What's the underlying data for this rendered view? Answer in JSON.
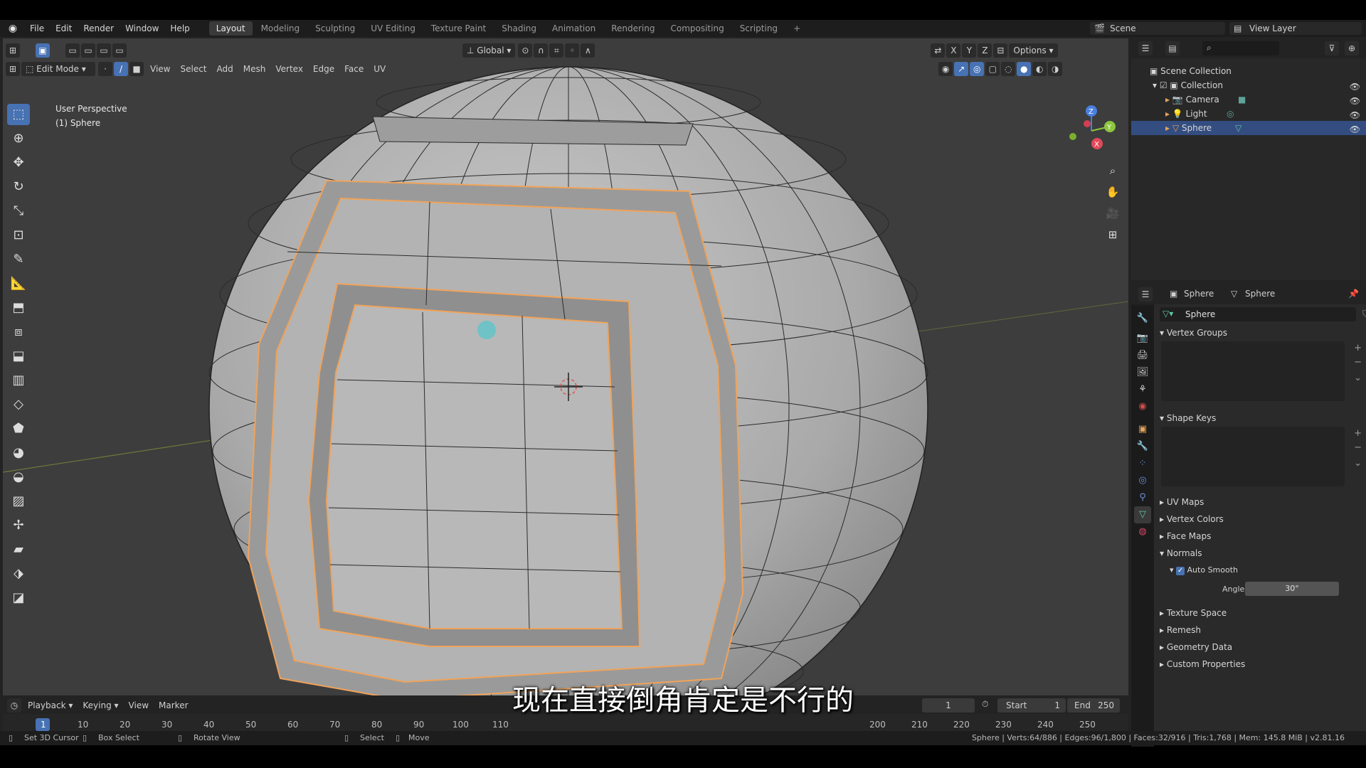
{
  "menu": [
    "File",
    "Edit",
    "Render",
    "Window",
    "Help"
  ],
  "workspaces": [
    {
      "label": "Layout",
      "active": true
    },
    {
      "label": "Modeling",
      "active": false
    },
    {
      "label": "Sculpting",
      "active": false
    },
    {
      "label": "UV Editing",
      "active": false
    },
    {
      "label": "Texture Paint",
      "active": false
    },
    {
      "label": "Shading",
      "active": false
    },
    {
      "label": "Animation",
      "active": false
    },
    {
      "label": "Rendering",
      "active": false
    },
    {
      "label": "Compositing",
      "active": false
    },
    {
      "label": "Scripting",
      "active": false
    }
  ],
  "add_workspace": "+",
  "scene": "Scene",
  "view_layer": "View Layer",
  "viewport": {
    "transform_orientation": "Global",
    "options_label": "Options",
    "axes": [
      "X",
      "Y",
      "Z"
    ],
    "mode": "Edit Mode",
    "menus": [
      "View",
      "Select",
      "Add",
      "Mesh",
      "Vertex",
      "Edge",
      "Face",
      "UV"
    ],
    "perspective_label": "User Perspective",
    "object_label": "(1) Sphere"
  },
  "outliner": {
    "root": "Scene Collection",
    "collection": "Collection",
    "items": [
      {
        "name": "Camera",
        "selected": false
      },
      {
        "name": "Light",
        "selected": false
      },
      {
        "name": "Sphere",
        "selected": true
      }
    ]
  },
  "properties": {
    "breadcrumb_object": "Sphere",
    "breadcrumb_data": "Sphere",
    "mesh_name": "Sphere",
    "panels": {
      "vertex_groups": "Vertex Groups",
      "shape_keys": "Shape Keys",
      "uv_maps": "UV Maps",
      "vertex_colors": "Vertex Colors",
      "face_maps": "Face Maps",
      "normals": "Normals",
      "auto_smooth": "Auto Smooth",
      "angle_label": "Angle",
      "angle_value": "30°",
      "texture_space": "Texture Space",
      "remesh": "Remesh",
      "geometry_data": "Geometry Data",
      "custom_properties": "Custom Properties"
    }
  },
  "timeline": {
    "menus": [
      "Playback",
      "Keying",
      "View",
      "Marker"
    ],
    "current_frame": "1",
    "start_label": "Start",
    "start_value": "1",
    "end_label": "End",
    "end_value": "250",
    "ticks": [
      "1",
      "10",
      "20",
      "30",
      "40",
      "50",
      "60",
      "70",
      "80",
      "90",
      "100",
      "110",
      "200",
      "210",
      "220",
      "230",
      "240",
      "250"
    ]
  },
  "status": {
    "hint1": "Set 3D Cursor",
    "hint2": "Box Select",
    "hint3": "Rotate View",
    "hint4": "Select",
    "hint5": "Move",
    "stats": "Sphere | Verts:64/886 | Edges:96/1,800 | Faces:32/916 | Tris:1,768 | Mem: 145.8 MiB | v2.81.16"
  },
  "subtitle": "现在直接倒角肯定是不行的",
  "colors": {
    "accent": "#4772b3",
    "selection_orange": "#f0a35a",
    "mesh_gray": "#b5b5b5",
    "viewport_bg": "#3d3d3d"
  }
}
